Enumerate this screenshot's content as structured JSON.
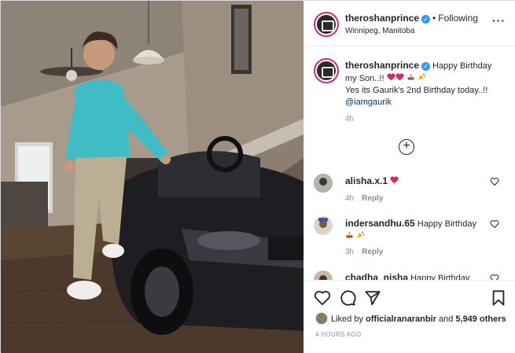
{
  "post": {
    "username": "theroshanprince",
    "follow_state": "Following",
    "location": "Winnipeg, Manitoba",
    "more_label": "•••"
  },
  "caption": {
    "username": "theroshanprince",
    "text_line1": "Happy Birthday my Son..!!",
    "text_line2": "Yes its Gaurik's 2nd Birthday today..!!",
    "mention": "@iamgaurik",
    "time": "4h"
  },
  "load_more_label": "+",
  "comments": [
    {
      "username": "alisha.x.1",
      "text": "",
      "time": "4h",
      "reply_label": "Reply"
    },
    {
      "username": "indersandhu.65",
      "text": "Happy Birthday",
      "time": "3h",
      "reply_label": "Reply"
    },
    {
      "username": "chadha_nisha",
      "text": "Happy Birthday",
      "time": "",
      "reply_label": ""
    }
  ],
  "likes": {
    "prefix": "Liked by",
    "user": "officialranaranbir",
    "connector": "and",
    "others": "5,949 others"
  },
  "timestamp": "4 HOURS AGO",
  "icons": {
    "verified": "verified-badge-icon",
    "like": "heart-outline-icon",
    "comment": "comment-bubble-icon",
    "share": "paper-plane-icon",
    "save": "bookmark-icon",
    "more": "ellipsis-icon",
    "load_more": "plus-circle-icon"
  },
  "colors": {
    "verified_blue": "#3897f0",
    "heart_red": "#ed4956",
    "secondary_text": "#8e8e8e",
    "mention": "#00376b"
  }
}
